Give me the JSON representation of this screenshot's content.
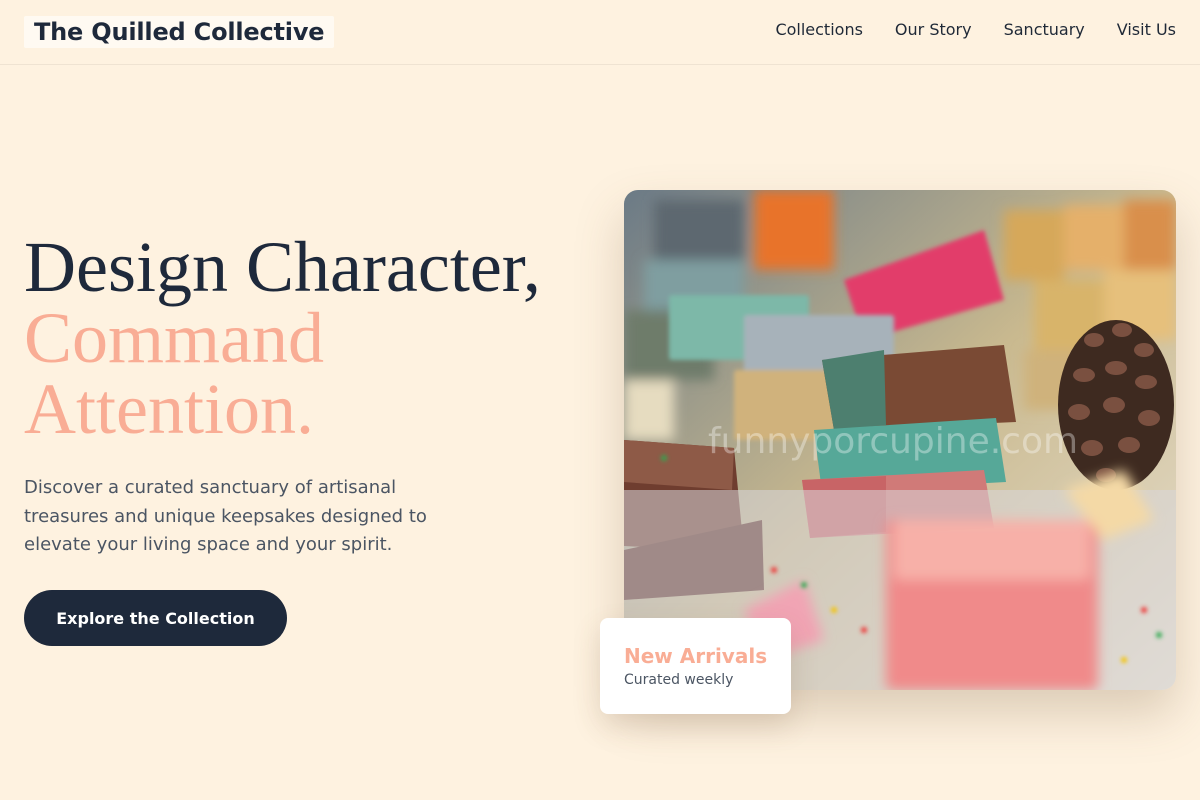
{
  "header": {
    "brand": "The Quilled Collective",
    "nav": [
      "Collections",
      "Our Story",
      "Sanctuary",
      "Visit Us"
    ]
  },
  "hero": {
    "title_line1": "Design Character,",
    "title_line2": "Command",
    "title_line3": "Attention.",
    "description": "Discover a curated sanctuary of artisanal treasures and unique keepsakes designed to elevate your living space and your spirit.",
    "cta_label": "Explore the Collection"
  },
  "image": {
    "watermark": "funnyporcupine.com"
  },
  "badge": {
    "title": "New Arrivals",
    "subtitle": "Curated weekly"
  },
  "colors": {
    "background": "#fef2e0",
    "navy": "#1e293b",
    "accent": "#f9ad95"
  }
}
